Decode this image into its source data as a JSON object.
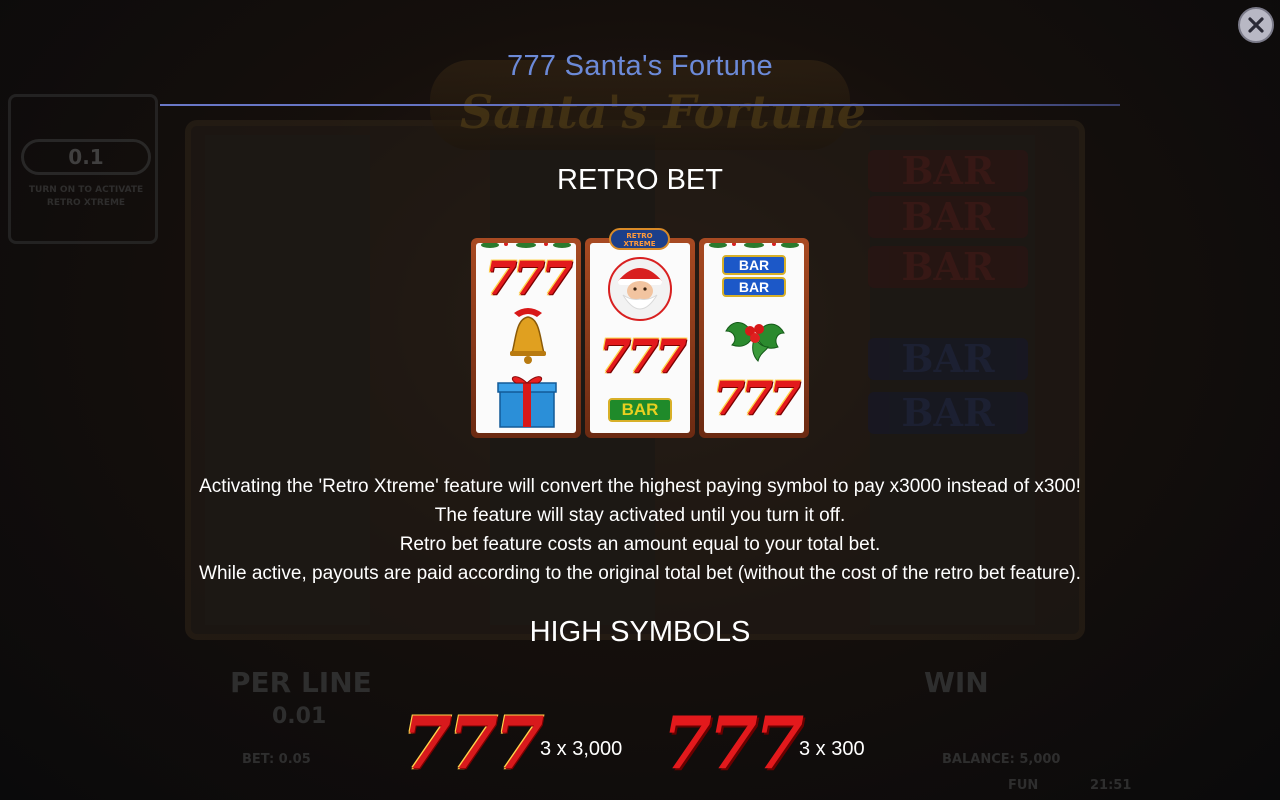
{
  "dialog": {
    "title": "777 Santa's Fortune",
    "close_icon": "close-icon"
  },
  "retro_bet": {
    "heading": "RETRO BET",
    "badge": [
      "RETRO",
      "XTREME"
    ],
    "reels": [
      [
        "777",
        "bell",
        "gift"
      ],
      [
        "santa",
        "777",
        "BAR"
      ],
      [
        "BAR BAR",
        "holly",
        "777"
      ]
    ],
    "bar_label": "BAR",
    "description": [
      "Activating the 'Retro Xtreme' feature will convert the highest paying symbol to pay x3000 instead of x300!",
      "The feature will stay activated until you turn it off.",
      "Retro bet feature costs an amount equal to your total bet.",
      "While active, payouts are paid according to the original total bet (without the cost of the retro bet feature)."
    ]
  },
  "high_symbols": {
    "heading": "HIGH SYMBOLS",
    "items": [
      {
        "symbol": "777",
        "pay": "3 x 3,000"
      },
      {
        "symbol": "777",
        "pay": "3 x 300"
      }
    ]
  },
  "background": {
    "logo_text": "Santa's Fortune",
    "panel_value": "0.1",
    "panel_hint": [
      "TURN ON TO ACTIVATE",
      "RETRO XTREME"
    ],
    "per_line_label": "PER LINE",
    "per_line_value": "0.01",
    "win_label": "WIN",
    "bet_text": "BET: 0.05",
    "balance_text": "BALANCE: 5,000",
    "fun_text": "FUN",
    "clock": "21:51",
    "bar_label": "BAR"
  },
  "colors": {
    "title": "#6c8ad8",
    "rule": "#5c6ab8",
    "seven_red": "#e3191c",
    "bar_green": "#1f8a2a",
    "bar_blue": "#1c58c8"
  }
}
